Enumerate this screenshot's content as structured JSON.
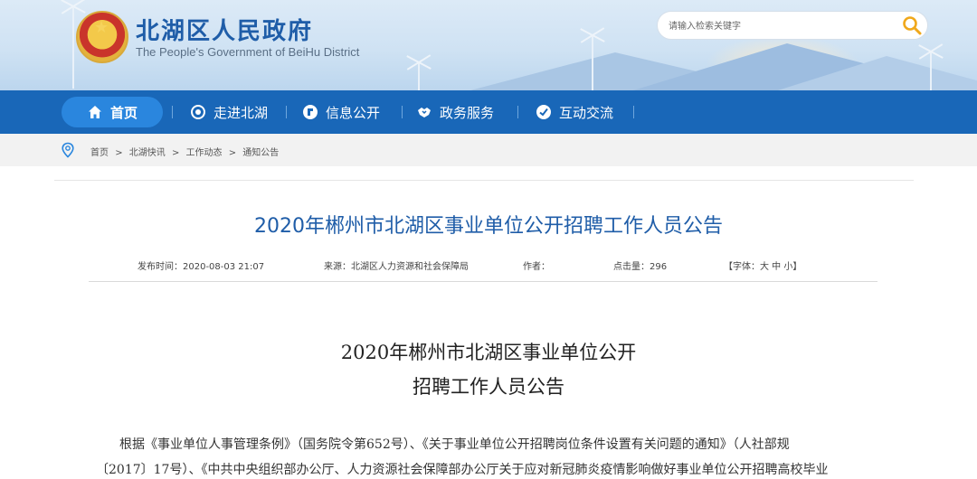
{
  "header": {
    "title": "北湖区人民政府",
    "subtitle": "The People's Government of BeiHu District",
    "search_placeholder": "请输入检索关键字"
  },
  "nav": {
    "items": [
      {
        "label": "首页",
        "icon": "home-icon"
      },
      {
        "label": "走进北湖",
        "icon": "target-icon"
      },
      {
        "label": "信息公开",
        "icon": "info-icon"
      },
      {
        "label": "政务服务",
        "icon": "handshake-icon"
      },
      {
        "label": "互动交流",
        "icon": "check-icon"
      }
    ]
  },
  "breadcrumb": {
    "items": [
      "首页",
      ">",
      "北湖快讯",
      ">",
      "工作动态",
      ">",
      "通知公告"
    ]
  },
  "article": {
    "title": "2020年郴州市北湖区事业单位公开招聘工作人员公告",
    "meta": {
      "published": "发布时间：2020-08-03 21:07",
      "source": "来源：北湖区人力资源和社会保障局",
      "author": "作者：",
      "hits": "点击量：296",
      "font_size": "【字体：大 中 小】"
    },
    "body_title_line1": "2020年郴州市北湖区事业单位公开",
    "body_title_line2": "招聘工作人员公告",
    "paragraph_line1": "根据《事业单位人事管理条例》（国务院令第652号）、《关于事业单位公开招聘岗位条件设置有关问题的通知》（人社部规",
    "paragraph_line2": "〔2017〕17号）、《中共中央组织部办公厅、人力资源社会保障部办公厅关于应对新冠肺炎疫情影响做好事业单位公开招聘高校毕业"
  },
  "colors": {
    "brand_blue": "#1f5da8",
    "nav_blue": "#1967b8",
    "nav_active": "#2a86de",
    "search_icon": "#f0a81b"
  }
}
